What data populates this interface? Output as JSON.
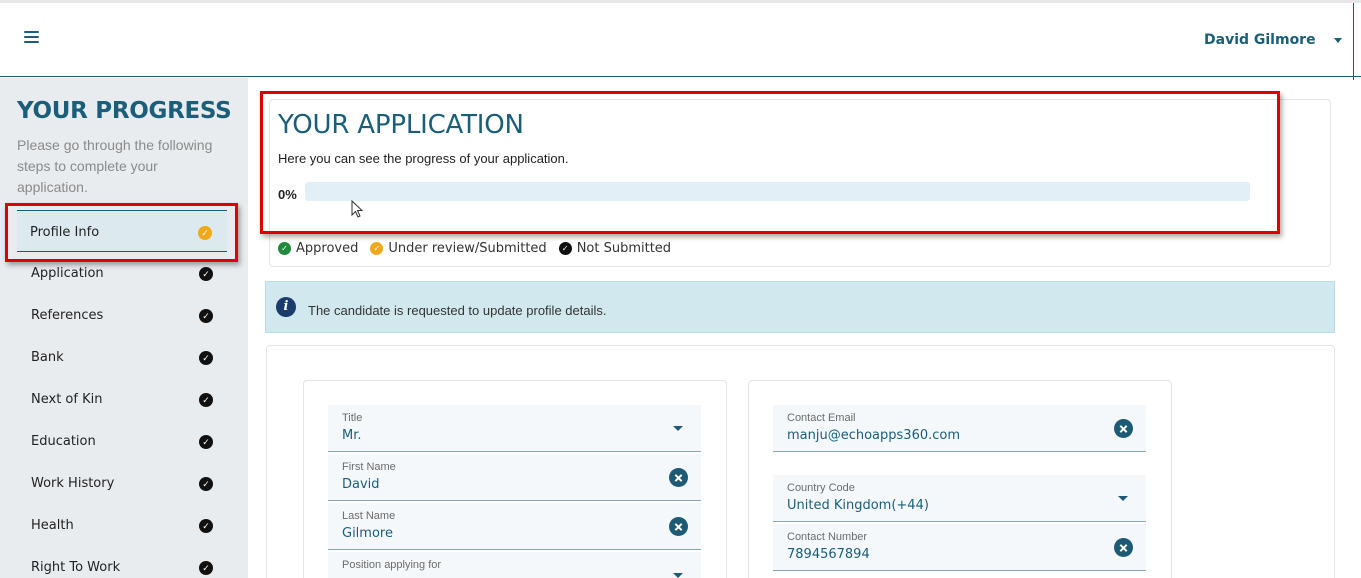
{
  "header": {
    "user_name": "David Gilmore"
  },
  "sidebar": {
    "title": "YOUR PROGRESS",
    "description": "Please go through the following steps to complete your application.",
    "steps": [
      {
        "label": "Profile Info",
        "status": "under-review"
      },
      {
        "label": "Application",
        "status": "not-submitted"
      },
      {
        "label": "References",
        "status": "not-submitted"
      },
      {
        "label": "Bank",
        "status": "not-submitted"
      },
      {
        "label": "Next of Kin",
        "status": "not-submitted"
      },
      {
        "label": "Education",
        "status": "not-submitted"
      },
      {
        "label": "Work History",
        "status": "not-submitted"
      },
      {
        "label": "Health",
        "status": "not-submitted"
      },
      {
        "label": "Right To Work",
        "status": "not-submitted"
      }
    ]
  },
  "application": {
    "title": "YOUR APPLICATION",
    "subtitle": "Here you can see the progress of your application.",
    "progress_label": "0%",
    "progress_fraction": 0,
    "legend": {
      "approved": "Approved",
      "under_review": "Under review/Submitted",
      "not_submitted": "Not Submitted"
    }
  },
  "alert": {
    "text": "The candidate is requested to update profile details."
  },
  "form": {
    "title": {
      "label": "Title",
      "value": "Mr."
    },
    "first_name": {
      "label": "First Name",
      "value": "David"
    },
    "last_name": {
      "label": "Last Name",
      "value": "Gilmore"
    },
    "position": {
      "label": "Position applying for",
      "value": ""
    },
    "contact_email": {
      "label": "Contact Email",
      "value": "manju@echoapps360.com"
    },
    "country_code": {
      "label": "Country Code",
      "value": "United Kingdom(+44)"
    },
    "contact_number": {
      "label": "Contact Number",
      "value": "7894567894"
    }
  },
  "colors": {
    "brand": "#1a5e7a",
    "approved": "#1e8a3a",
    "under_review": "#f0a91b",
    "not_submitted": "#111111",
    "highlight": "#e00000"
  },
  "icons": {
    "menu": "hamburger-icon",
    "user_caret": "caret-down-icon",
    "info": "info-circle-icon",
    "clear": "clear-circle-icon",
    "dropdown": "caret-down-icon"
  }
}
